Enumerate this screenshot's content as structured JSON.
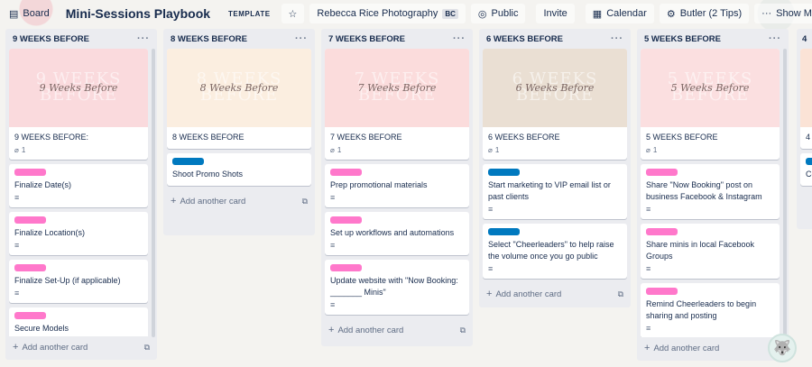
{
  "header": {
    "board_view": "Board",
    "board_title": "Mini-Sessions Playbook",
    "template_tag": "TEMPLATE",
    "workspace": "Rebecca Rice Photography",
    "workspace_badge": "BC",
    "visibility": "Public",
    "invite": "Invite",
    "calendar": "Calendar",
    "butler": "Butler (2 Tips)",
    "show_menu": "Show Menu"
  },
  "lists": [
    {
      "title": "9 WEEKS BEFORE",
      "add_card": "Add another card",
      "cover_card": {
        "cover_color": "#fadadd",
        "cover_big": "9 WEEKS BEFORE",
        "cover_script": "9 Weeks Before",
        "title": "9 WEEKS BEFORE:",
        "attachments": "1"
      },
      "cards": [
        {
          "title": "Finalize Date(s)",
          "label_color": "#ff78cb"
        },
        {
          "title": "Finalize Location(s)",
          "label_color": "#ff78cb"
        },
        {
          "title": "Finalize Set-Up (if applicable)",
          "label_color": "#ff78cb"
        },
        {
          "title": "Secure Models",
          "label_color": "#ff78cb"
        }
      ]
    },
    {
      "title": "8 WEEKS BEFORE",
      "add_card": "Add another card",
      "cover_card": {
        "cover_color": "#fbeee0",
        "cover_big": "8 WEEKS BEFORE",
        "cover_script": "8 Weeks Before",
        "title": "8 WEEKS BEFORE",
        "attachments": ""
      },
      "cards": [
        {
          "title": "Shoot Promo Shots",
          "label_color": "#0079bf"
        }
      ]
    },
    {
      "title": "7 WEEKS BEFORE",
      "add_card": "Add another card",
      "cover_card": {
        "cover_color": "#fbdcdc",
        "cover_big": "7 WEEKS BEFORE",
        "cover_script": "7 Weeks Before",
        "title": "7 WEEKS BEFORE",
        "attachments": "1"
      },
      "cards": [
        {
          "title": "Prep promotional materials",
          "label_color": "#ff78cb"
        },
        {
          "title": "Set up workflows and automations",
          "label_color": "#ff78cb"
        },
        {
          "title": "Update website with \"Now Booking: _______ Minis\"",
          "label_color": "#ff78cb"
        }
      ]
    },
    {
      "title": "6 WEEKS BEFORE",
      "add_card": "Add another card",
      "cover_card": {
        "cover_color": "#eadfd3",
        "cover_big": "6 WEEKS BEFORE",
        "cover_script": "6 Weeks Before",
        "title": "6 WEEKS BEFORE",
        "attachments": "1"
      },
      "cards": [
        {
          "title": "Start marketing to VIP email list or past clients",
          "label_color": "#0079bf"
        },
        {
          "title": "Select \"Cheerleaders\" to help raise the volume once you go public",
          "label_color": "#0079bf"
        }
      ]
    },
    {
      "title": "5 WEEKS BEFORE",
      "add_card": "Add another card",
      "cover_card": {
        "cover_color": "#fbdfe0",
        "cover_big": "5 WEEKS BEFORE",
        "cover_script": "5 Weeks Before",
        "title": "5 WEEKS BEFORE",
        "attachments": "1"
      },
      "cards": [
        {
          "title": "Share \"Now Booking\" post on business Facebook & Instagram",
          "label_color": "#ff78cb"
        },
        {
          "title": "Share minis in local Facebook Groups",
          "label_color": "#ff78cb"
        },
        {
          "title": "Remind Cheerleaders to begin sharing and posting",
          "label_color": "#ff78cb"
        }
      ]
    },
    {
      "title": "4",
      "add_card": "",
      "cover_card": {
        "cover_color": "#fbe3d6",
        "cover_big": "",
        "cover_script": "",
        "title": "4",
        "attachments": ""
      },
      "cards": [
        {
          "title": "Co",
          "label_color": "#0079bf"
        }
      ]
    }
  ]
}
